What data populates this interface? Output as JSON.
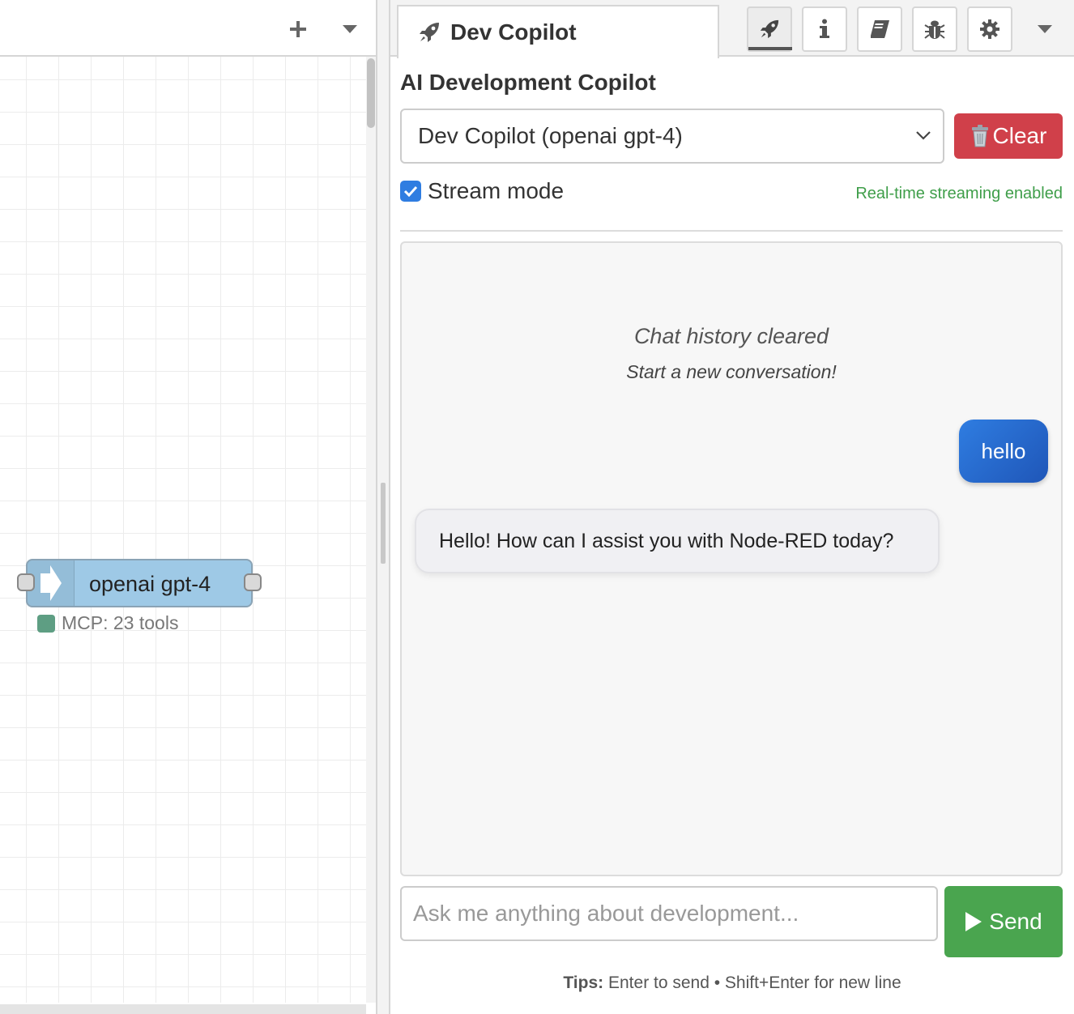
{
  "workspace": {
    "add_icon": "plus-icon",
    "menu_icon": "caret-down-icon",
    "node": {
      "label": "openai gpt-4",
      "icon": "arrow-right-icon",
      "color": "#9ec9e6",
      "status_text": "MCP: 23 tools",
      "status_color": "#5e9e83"
    }
  },
  "sidebar": {
    "tab": {
      "icon": "rocket-icon",
      "title": "Dev Copilot"
    },
    "tab_buttons": [
      "rocket-icon",
      "info-icon",
      "book-icon",
      "bug-icon",
      "gear-icon"
    ],
    "menu_icon": "caret-down-icon",
    "panel_title": "AI Development Copilot",
    "model_select": {
      "value": "Dev Copilot (openai gpt-4)"
    },
    "clear_button": {
      "icon": "trash-icon",
      "label": "Clear",
      "color": "#d0404a"
    },
    "stream": {
      "label": "Stream mode",
      "checked": true,
      "status": "Real-time streaming enabled",
      "status_color": "#3f9e4a"
    },
    "chat": {
      "cleared_title": "Chat history cleared",
      "cleared_sub": "Start a new conversation!",
      "messages": [
        {
          "role": "user",
          "text": "hello"
        },
        {
          "role": "assistant",
          "text": "Hello! How can I assist you with Node-RED today?"
        }
      ]
    },
    "input": {
      "placeholder": "Ask me anything about development...",
      "value": ""
    },
    "send_button": {
      "icon": "play-icon",
      "label": "Send",
      "color": "#4aa54f"
    },
    "tips": {
      "label": "Tips:",
      "text": " Enter to send • Shift+Enter for new line"
    }
  }
}
